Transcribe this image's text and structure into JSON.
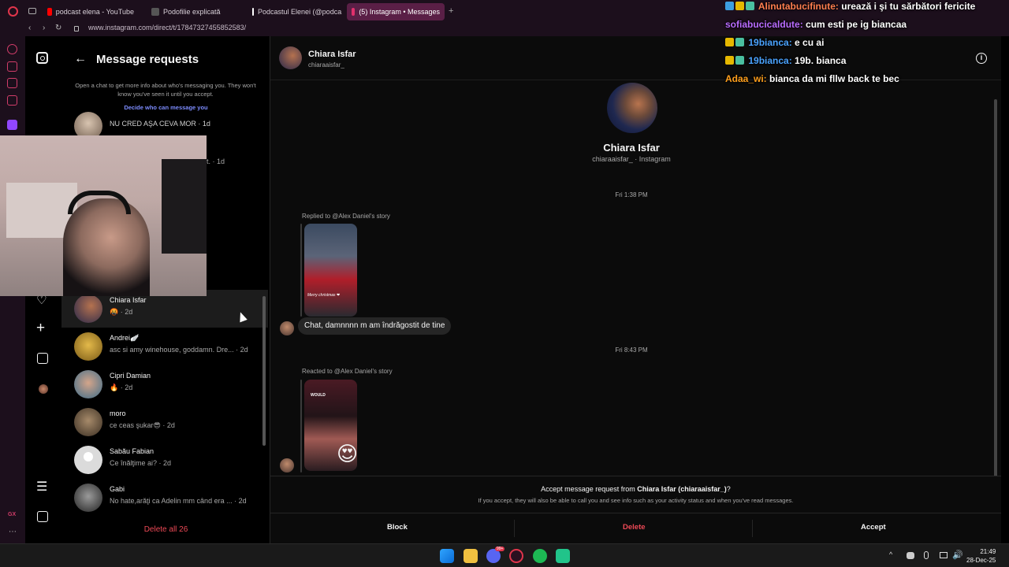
{
  "browser": {
    "tabs": [
      {
        "label": "podcast elena - YouTube",
        "color": "#ff0000"
      },
      {
        "label": "Podofilie explicată",
        "color": "#888888"
      },
      {
        "label": "Podcastul Elenei (@podca",
        "color": "#ffffff"
      },
      {
        "label": "(5) Instagram • Messages",
        "color": "#e1306c"
      }
    ],
    "new_tab": "+",
    "url": "www.instagram.com/direct/t/17847327455852583/"
  },
  "requests": {
    "title": "Message requests",
    "note": "Open a chat to get more info about who's messaging you. They won't know you've seen it until you accept.",
    "link": "Decide who can message you",
    "partial_top": {
      "preview": "NU CRED AŞA CEVA MOR · 1d",
      "preview2": "t. · 1d"
    },
    "items": [
      {
        "name": "Chiara Isfar",
        "preview": "🤬 · 2d"
      },
      {
        "name": "Andrei🪽",
        "preview": "asc si amy winehouse, goddamn. Dre... · 2d"
      },
      {
        "name": "Cipri Damian",
        "preview": "🔥 · 2d"
      },
      {
        "name": "moro",
        "preview": "ce ceas şukar😎 · 2d"
      },
      {
        "name": "Sabău Fabian",
        "preview": "Ce înălţime ai? · 2d"
      },
      {
        "name": "Gabi",
        "preview": "No hate,arăţi ca Adelin mm când era ... · 2d"
      }
    ],
    "delete_all": "Delete all 26"
  },
  "chat": {
    "name": "Chiara Isfar",
    "handle": "chiaraaisfar_",
    "profile_name": "Chiara Isfar",
    "profile_sub": "chiaraaisfar_ · Instagram",
    "ts1": "Fri 1:38 PM",
    "replied": "Replied to @Alex Daniel's story",
    "story1_caption": "Merry christmas ❤",
    "message": "Chat, damnnnn m am îndrăgostit de tine",
    "ts2": "Fri 8:43 PM",
    "reacted": "Reacted to @Alex Daniel's story",
    "story2_caption": "WOULD",
    "reaction": "😍",
    "accept_prefix": "Accept message request from ",
    "accept_name": "Chiara Isfar (chiaraaisfar_)",
    "accept_suffix": "?",
    "accept_note": "If you accept, they will also be able to call you and see info such as your activity status and when you've read messages.",
    "block": "Block",
    "delete": "Delete",
    "accept": "Accept"
  },
  "twitch_chat": [
    {
      "user": "Alinutabucifinute:",
      "msg": "urează i şi tu sărbători fericite",
      "color": "#ff7f50"
    },
    {
      "user": "sofiabucicaldute:",
      "msg": "cum esti pe ig biancaa",
      "color": "#b96cff"
    },
    {
      "user": "19bianca:",
      "msg": "e cu ai",
      "color": "#4aa3ff"
    },
    {
      "user": "19bianca:",
      "msg": "19b. bianca",
      "color": "#4aa3ff"
    },
    {
      "user": "Adaa_wi:",
      "msg": "bianca da mi fllw back te bec",
      "color": "#ff9f1c"
    }
  ],
  "taskbar": {
    "time": "21:49",
    "date": "28-Dec-25",
    "badge": "99+"
  }
}
